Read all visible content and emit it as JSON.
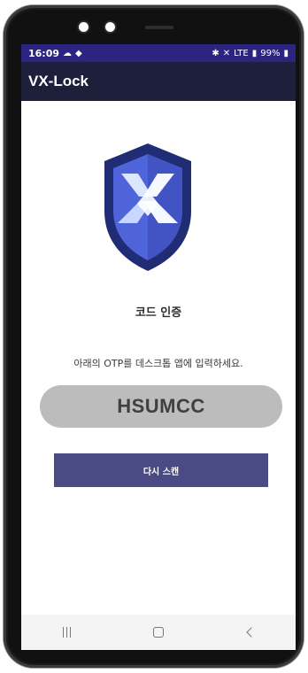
{
  "status_bar": {
    "time": "16:09",
    "battery": "99%",
    "network_label": "LTE",
    "notification_icons": [
      "cloud-icon",
      "diamond-icon"
    ],
    "system_icons": [
      "bluetooth-icon",
      "mute-icon",
      "signal-icon",
      "battery-icon"
    ]
  },
  "app_bar": {
    "title": "VX-Lock"
  },
  "main": {
    "heading": "코드 인증",
    "instruction": "아래의 OTP를 데스크톱 앱에 입력하세요.",
    "otp_code": "HSUMCC",
    "rescan_button_label": "다시 스캔"
  },
  "logo": {
    "icon": "shield-x-logo-icon",
    "colors": {
      "outer": "#202c73",
      "inner": "#4f64d9",
      "inner_dark": "#3f50bd",
      "mark": "#dbe7ff"
    }
  },
  "nav_bar": {
    "buttons": [
      {
        "name": "recents-icon"
      },
      {
        "name": "home-icon"
      },
      {
        "name": "back-icon"
      }
    ]
  },
  "colors": {
    "status_bar": "#2b2480",
    "app_bar": "#1d1f3b",
    "otp_background": "#bcbcbc",
    "button": "#4a4a85"
  }
}
